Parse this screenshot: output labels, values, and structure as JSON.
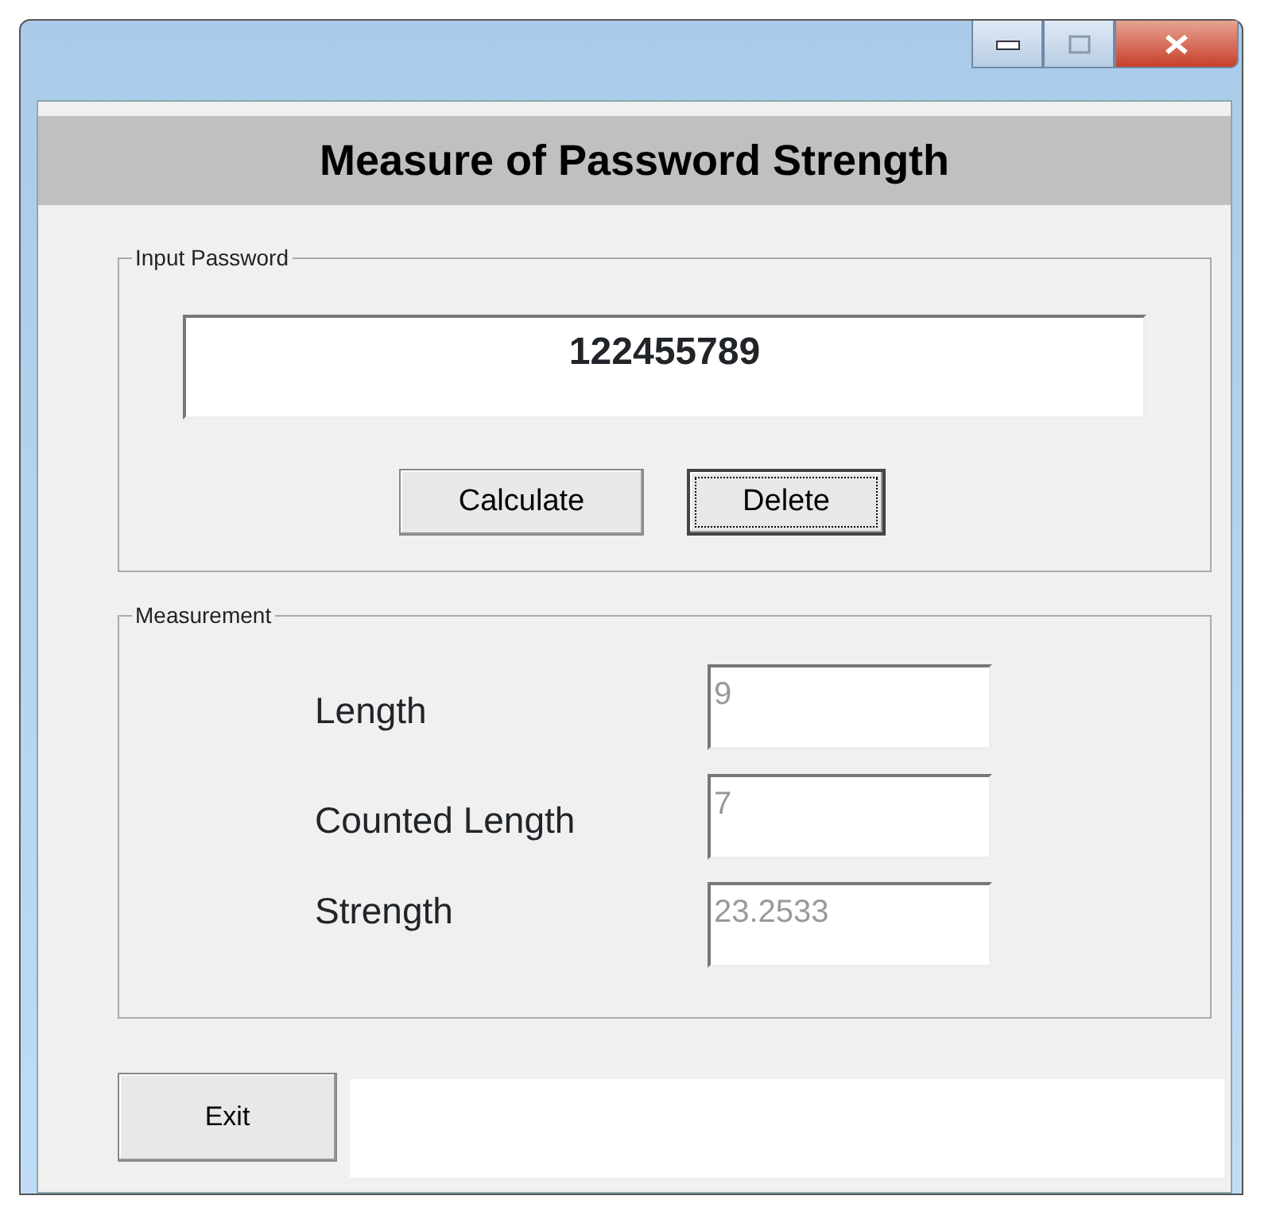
{
  "window": {
    "title_bar_buttons": [
      {
        "kind": "minimize"
      },
      {
        "kind": "maximize"
      },
      {
        "kind": "close"
      }
    ]
  },
  "header": "Measure of Password Strength",
  "input_group": {
    "legend": "Input Password",
    "password": {
      "value": "122455789"
    },
    "buttons": [
      {
        "label": "Calculate",
        "focused": false
      },
      {
        "label": "Delete",
        "focused": true
      }
    ]
  },
  "measurement_group": {
    "legend": "Measurement",
    "fields": [
      {
        "label": "Length",
        "value": "9",
        "disabled": true
      },
      {
        "label": "Counted Length",
        "value": "7",
        "disabled": true
      },
      {
        "label": "Strength",
        "value": "23.2533",
        "disabled": true
      }
    ]
  },
  "exit_button": "Exit"
}
